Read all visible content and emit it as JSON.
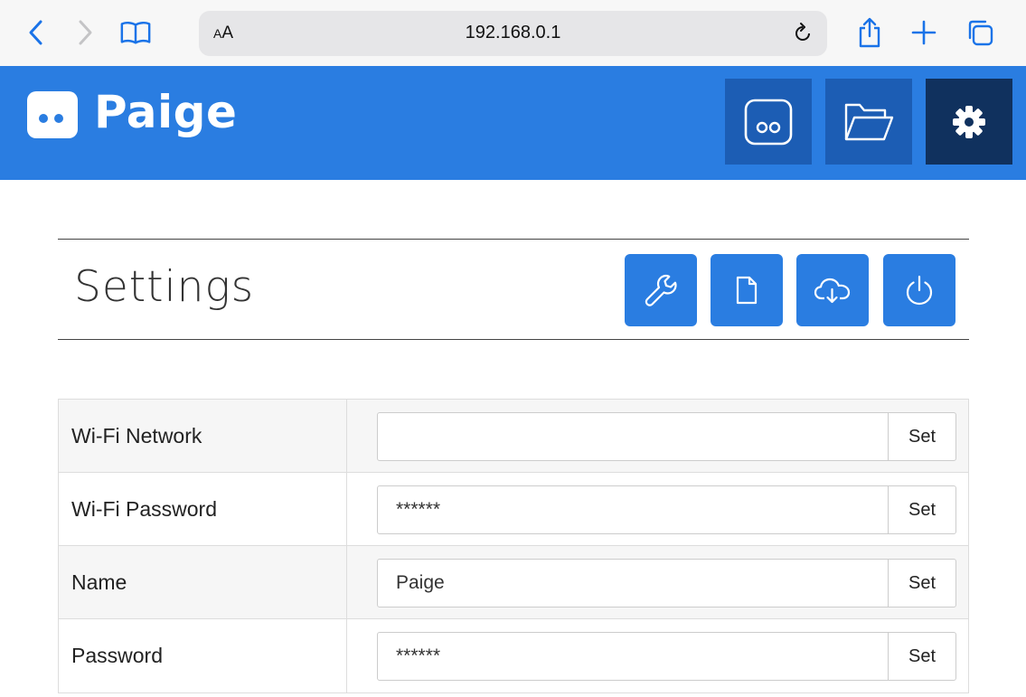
{
  "browser": {
    "aa_label": "AA",
    "url": "192.168.0.1",
    "icons": [
      "back-icon",
      "forward-icon",
      "book-icon",
      "reload-icon",
      "share-icon",
      "plus-icon",
      "tabs-icon"
    ]
  },
  "header": {
    "brand": "Paige",
    "nav": [
      "dashboard-icon",
      "folder-icon",
      "gear-icon"
    ],
    "active": "gear-icon",
    "colors": {
      "bar": "#2a7de1",
      "button": "#1c5db4",
      "active_button": "#10315e"
    }
  },
  "page": {
    "title": "Settings",
    "tools": [
      "wrench-icon",
      "document-icon",
      "cloud-download-icon",
      "power-icon"
    ]
  },
  "settings": {
    "rows": [
      {
        "label": "Wi-Fi Network",
        "value": "",
        "button": "Set"
      },
      {
        "label": "Wi-Fi Password",
        "value": "******",
        "button": "Set"
      },
      {
        "label": "Name",
        "value": "Paige",
        "button": "Set"
      },
      {
        "label": "Password",
        "value": "******",
        "button": "Set"
      }
    ]
  }
}
